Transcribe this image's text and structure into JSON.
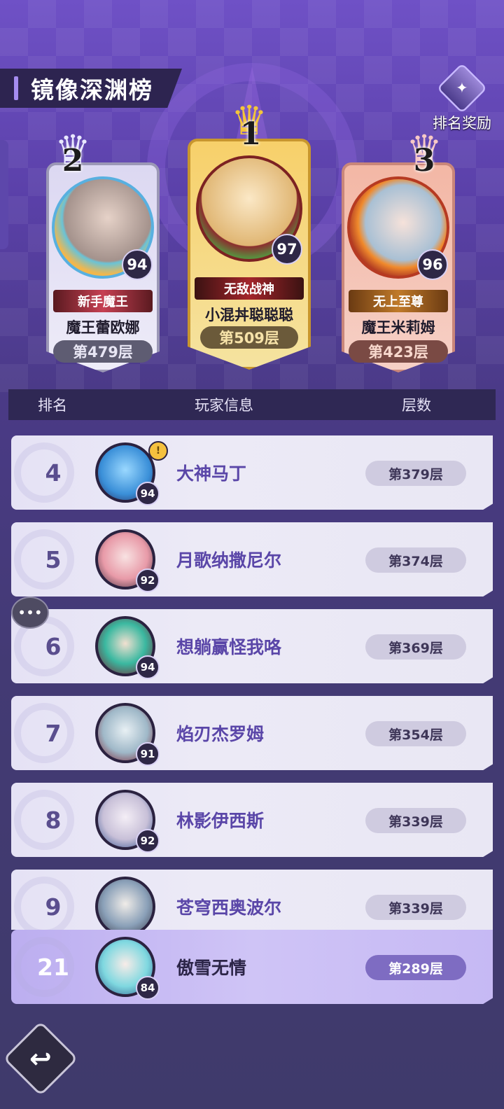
{
  "page_title": "镜像深渊榜",
  "reward_button": {
    "label": "排名奖励",
    "icon": "trophy-icon"
  },
  "podium": [
    {
      "rank": "1",
      "name": "小混丼聪聪聪",
      "level": "97",
      "title": "无敌战神",
      "floor": "第509层"
    },
    {
      "rank": "2",
      "name": "魔王蕾欧娜",
      "level": "94",
      "title": "新手魔王",
      "floor": "第479层"
    },
    {
      "rank": "3",
      "name": "魔王米莉姆",
      "level": "96",
      "title": "无上至尊",
      "floor": "第423层"
    }
  ],
  "table_header": {
    "rank": "排名",
    "info": "玩家信息",
    "floor": "层数"
  },
  "rows": [
    {
      "rank": "4",
      "name": "大神马丁",
      "level": "94",
      "floor": "第379层",
      "avatar_color": "#3a8fd8",
      "badge": "!"
    },
    {
      "rank": "5",
      "name": "月歌纳撒尼尔",
      "level": "92",
      "floor": "第374层",
      "avatar_color": "#e89aa8"
    },
    {
      "rank": "6",
      "name": "想躺赢怪我咯",
      "level": "94",
      "floor": "第369层",
      "avatar_color": "#3ab8a0"
    },
    {
      "rank": "7",
      "name": "焰刃杰罗姆",
      "level": "91",
      "floor": "第354层",
      "avatar_color": "#9fb8c8"
    },
    {
      "rank": "8",
      "name": "林影伊西斯",
      "level": "92",
      "floor": "第339层",
      "avatar_color": "#c8c0d8"
    },
    {
      "rank": "9",
      "name": "苍穹西奥波尔",
      "level": "",
      "floor": "第339层",
      "avatar_color": "#8aa0b8"
    }
  ],
  "self_row": {
    "rank": "21",
    "name": "傲雪无情",
    "level": "84",
    "floor": "第289层",
    "avatar_color": "#7fd8e0"
  },
  "icons": {
    "chat": "chat-bubble-icon",
    "back": "back-arrow-icon"
  }
}
